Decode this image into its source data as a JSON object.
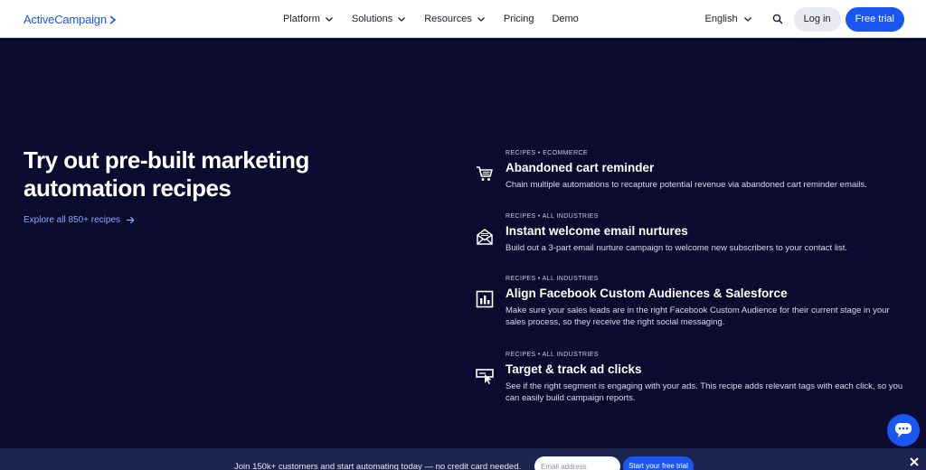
{
  "nav": {
    "logo": "ActiveCampaign",
    "items": [
      {
        "label": "Platform",
        "dropdown": true
      },
      {
        "label": "Solutions",
        "dropdown": true
      },
      {
        "label": "Resources",
        "dropdown": true
      },
      {
        "label": "Pricing",
        "dropdown": false
      },
      {
        "label": "Demo",
        "dropdown": false
      }
    ],
    "language": "English",
    "login": "Log in",
    "free_trial": "Free trial"
  },
  "hero": {
    "title": "Try out pre-built marketing automation recipes",
    "explore": "Explore all 850+ recipes"
  },
  "recipes": [
    {
      "tag": "RECIPES • ECOMMERCE",
      "icon": "cart-icon",
      "title": "Abandoned cart reminder",
      "description": "Chain multiple automations to recapture potential revenue via abandoned cart reminder emails."
    },
    {
      "tag": "RECIPES • ALL INDUSTRIES",
      "icon": "email-icon",
      "title": "Instant welcome email nurtures",
      "description": "Build out a 3-part email nurture campaign to welcome new subscribers to your contact list."
    },
    {
      "tag": "RECIPES • ALL INDUSTRIES",
      "icon": "chart-icon",
      "title": "Align Facebook Custom Audiences & Salesforce",
      "description": "Make sure your sales leads are in the right Facebook Custom Audience for their current stage in your sales process, so they receive the right social messaging."
    },
    {
      "tag": "RECIPES • ALL INDUSTRIES",
      "icon": "ad-click-icon",
      "title": "Target & track ad clicks",
      "description": "See if the right segment is engaging with your ads. This recipe adds relevant tags with each click, so you can easily build campaign reports."
    }
  ],
  "bottom_bar": {
    "text": "Join 150k+ customers and start automating today — no credit card needed.",
    "email_placeholder": "Email address",
    "cta": "Start your free trial"
  },
  "colors": {
    "brand_blue": "#1a56f0",
    "hero_bg": "#0a0b2e",
    "bar_bg": "#1e2450",
    "link": "#8ea8ff"
  }
}
